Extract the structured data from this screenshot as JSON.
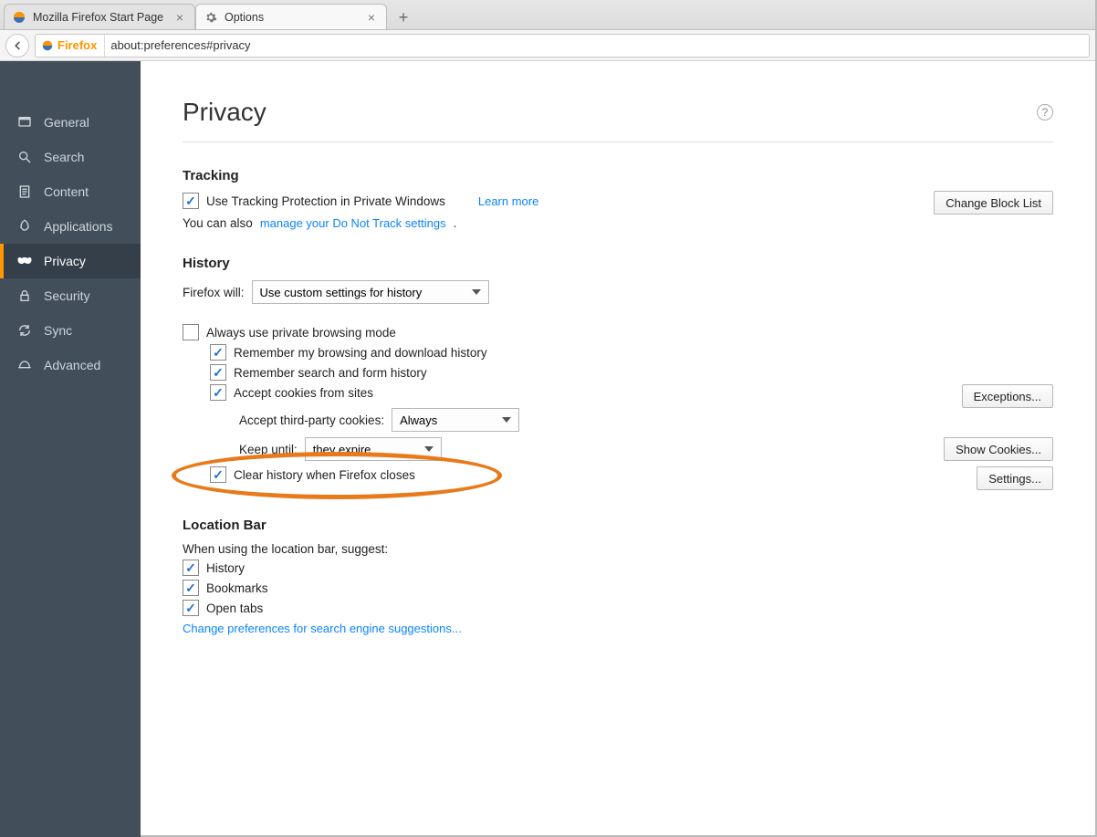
{
  "tabs": [
    {
      "title": "Mozilla Firefox Start Page"
    },
    {
      "title": "Options"
    }
  ],
  "identity_label": "Firefox",
  "url": "about:preferences#privacy",
  "sidebar": {
    "items": [
      {
        "label": "General"
      },
      {
        "label": "Search"
      },
      {
        "label": "Content"
      },
      {
        "label": "Applications"
      },
      {
        "label": "Privacy"
      },
      {
        "label": "Security"
      },
      {
        "label": "Sync"
      },
      {
        "label": "Advanced"
      }
    ]
  },
  "page": {
    "title": "Privacy"
  },
  "tracking": {
    "heading": "Tracking",
    "use_tp_label": "Use Tracking Protection in Private Windows",
    "learn_more": "Learn more",
    "dnt_prefix": "You can also ",
    "dnt_link": "manage your Do Not Track settings",
    "change_block_list": "Change Block List"
  },
  "history": {
    "heading": "History",
    "will_label": "Firefox will:",
    "will_value": "Use custom settings for history",
    "always_private": "Always use private browsing mode",
    "remember_browsing": "Remember my browsing and download history",
    "remember_search": "Remember search and form history",
    "accept_cookies": "Accept cookies from sites",
    "third_party_label": "Accept third-party cookies:",
    "third_party_value": "Always",
    "keep_until_label": "Keep until:",
    "keep_until_value": "they expire",
    "clear_on_close": "Clear history when Firefox closes",
    "exceptions_btn": "Exceptions...",
    "show_cookies_btn": "Show Cookies...",
    "settings_btn": "Settings..."
  },
  "location_bar": {
    "heading": "Location Bar",
    "suggest_label": "When using the location bar, suggest:",
    "history": "History",
    "bookmarks": "Bookmarks",
    "open_tabs": "Open tabs",
    "search_prefs_link": "Change preferences for search engine suggestions..."
  }
}
